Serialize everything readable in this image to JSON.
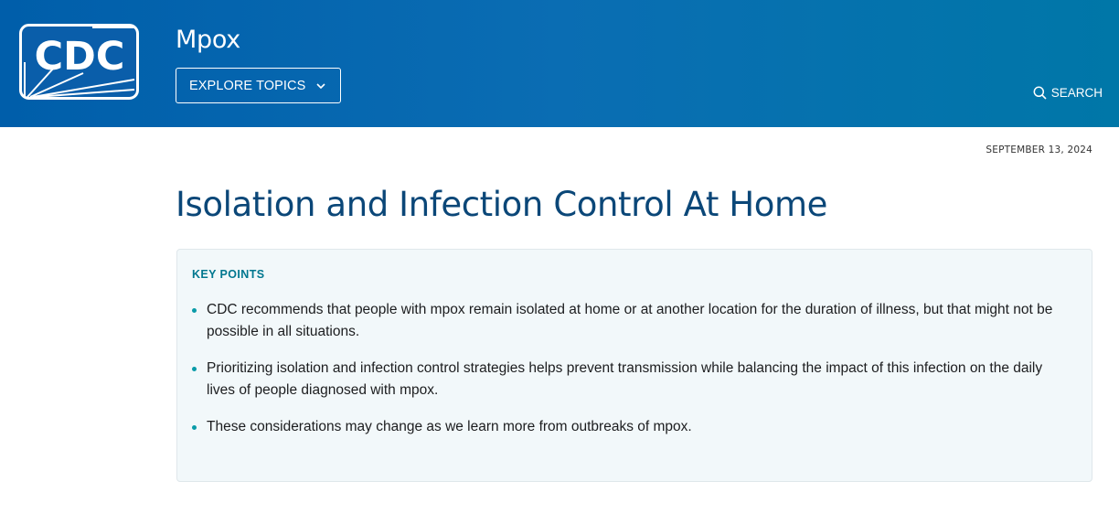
{
  "header": {
    "logo_text": "CDC",
    "site_title": "Mpox",
    "explore_label": "EXPLORE TOPICS",
    "search_label": "SEARCH"
  },
  "icons": {
    "logo": "cdc-logo",
    "explore": "chevron-down-icon",
    "search": "search-icon"
  },
  "colors": {
    "header_start": "#005eaa",
    "header_end": "#0077a8",
    "title": "#0b4778",
    "key_points_heading": "#00778f",
    "bullet": "#0a9ba8",
    "key_points_bg": "#f2f8fa"
  },
  "main": {
    "date": "SEPTEMBER 13, 2024",
    "title": "Isolation and Infection Control At Home",
    "key_points": {
      "heading": "KEY POINTS",
      "items": [
        "CDC recommends that people with mpox remain isolated at home or at another location for the duration of illness, but that might not be possible in all situations.",
        "Prioritizing isolation and infection control strategies helps prevent transmission while balancing the impact of this infection on the daily lives of people diagnosed with mpox.",
        "These considerations may change as we learn more from outbreaks of mpox."
      ]
    }
  }
}
